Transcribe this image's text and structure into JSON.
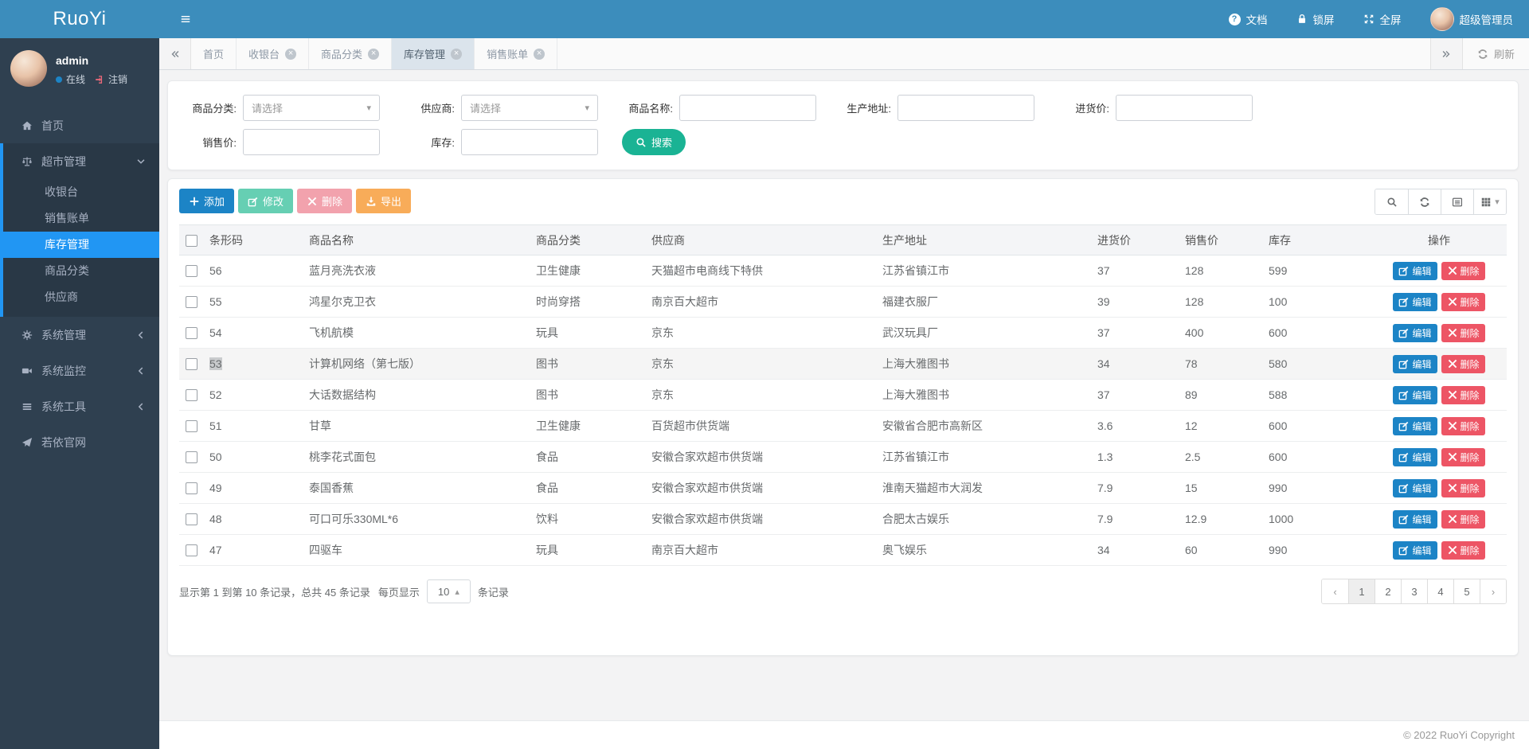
{
  "colors": {
    "navbar": "#3c8dbc",
    "sidebar": "#2f4050",
    "active_menu": "#2196f3",
    "primary": "#1c84c6",
    "success": "#1ab394",
    "danger": "#ed5565",
    "warning": "#f8ac59"
  },
  "navbar": {
    "logo": "RuoYi",
    "doc": "文档",
    "lock": "锁屏",
    "fullscreen": "全屏",
    "user": "超级管理员"
  },
  "sidebar": {
    "username": "admin",
    "status": "在线",
    "logout": "注销",
    "menu": [
      {
        "label": "首页",
        "icon": "home-icon",
        "type": "item"
      },
      {
        "label": "超市管理",
        "icon": "scale-icon",
        "type": "group",
        "expanded": true,
        "children": [
          {
            "label": "收银台"
          },
          {
            "label": "销售账单"
          },
          {
            "label": "库存管理",
            "active": true
          },
          {
            "label": "商品分类"
          },
          {
            "label": "供应商"
          }
        ]
      },
      {
        "label": "系统管理",
        "icon": "gear-icon",
        "type": "collapsed"
      },
      {
        "label": "系统监控",
        "icon": "camera-icon",
        "type": "collapsed"
      },
      {
        "label": "系统工具",
        "icon": "bars-icon",
        "type": "collapsed"
      },
      {
        "label": "若依官网",
        "icon": "plane-icon",
        "type": "item"
      }
    ]
  },
  "tabbar": {
    "tabs": [
      {
        "label": "首页",
        "closable": false,
        "active": false
      },
      {
        "label": "收银台",
        "closable": true,
        "active": false
      },
      {
        "label": "商品分类",
        "closable": true,
        "active": false
      },
      {
        "label": "库存管理",
        "closable": true,
        "active": true
      },
      {
        "label": "销售账单",
        "closable": true,
        "active": false
      }
    ],
    "refresh": "刷新"
  },
  "search": {
    "row1": [
      {
        "label": "商品分类:",
        "type": "select",
        "placeholder": "请选择"
      },
      {
        "label": "供应商:",
        "type": "select",
        "placeholder": "请选择"
      },
      {
        "label": "商品名称:",
        "type": "input",
        "value": ""
      },
      {
        "label": "生产地址:",
        "type": "input",
        "value": ""
      },
      {
        "label": "进货价:",
        "type": "input",
        "value": ""
      }
    ],
    "row2": [
      {
        "label": "销售价:",
        "type": "input",
        "value": ""
      },
      {
        "label": "库存:",
        "type": "input",
        "value": ""
      }
    ],
    "search_button": "搜索"
  },
  "toolbar": {
    "add": "添加",
    "modify": "修改",
    "remove": "删除",
    "export": "导出"
  },
  "table": {
    "columns": [
      "条形码",
      "商品名称",
      "商品分类",
      "供应商",
      "生产地址",
      "进货价",
      "销售价",
      "库存",
      "操作"
    ],
    "edit_label": "编辑",
    "delete_label": "删除",
    "rows": [
      {
        "barcode": "56",
        "name": "蓝月亮洗衣液",
        "category": "卫生健康",
        "supplier": "天猫超市电商线下特供",
        "address": "江苏省镇江市",
        "purchase_price": "37",
        "sale_price": "128",
        "stock": "599"
      },
      {
        "barcode": "55",
        "name": "鸿星尔克卫衣",
        "category": "时尚穿搭",
        "supplier": "南京百大超市",
        "address": "福建衣服厂",
        "purchase_price": "39",
        "sale_price": "128",
        "stock": "100"
      },
      {
        "barcode": "54",
        "name": "飞机航模",
        "category": "玩具",
        "supplier": "京东",
        "address": "武汉玩具厂",
        "purchase_price": "37",
        "sale_price": "400",
        "stock": "600"
      },
      {
        "barcode": "53",
        "name": "计算机网络（第七版）",
        "category": "图书",
        "supplier": "京东",
        "address": "上海大雅图书",
        "purchase_price": "34",
        "sale_price": "78",
        "stock": "580",
        "highlighted": true,
        "selected": true
      },
      {
        "barcode": "52",
        "name": "大话数据结构",
        "category": "图书",
        "supplier": "京东",
        "address": "上海大雅图书",
        "purchase_price": "37",
        "sale_price": "89",
        "stock": "588"
      },
      {
        "barcode": "51",
        "name": "甘草",
        "category": "卫生健康",
        "supplier": "百货超市供货端",
        "address": "安徽省合肥市高新区",
        "purchase_price": "3.6",
        "sale_price": "12",
        "stock": "600"
      },
      {
        "barcode": "50",
        "name": "桃李花式面包",
        "category": "食品",
        "supplier": "安徽合家欢超市供货端",
        "address": "江苏省镇江市",
        "purchase_price": "1.3",
        "sale_price": "2.5",
        "stock": "600"
      },
      {
        "barcode": "49",
        "name": "泰国香蕉",
        "category": "食品",
        "supplier": "安徽合家欢超市供货端",
        "address": "淮南天猫超市大润发",
        "purchase_price": "7.9",
        "sale_price": "15",
        "stock": "990"
      },
      {
        "barcode": "48",
        "name": "可口可乐330ML*6",
        "category": "饮料",
        "supplier": "安徽合家欢超市供货端",
        "address": "合肥太古娱乐",
        "purchase_price": "7.9",
        "sale_price": "12.9",
        "stock": "1000"
      },
      {
        "barcode": "47",
        "name": "四驱车",
        "category": "玩具",
        "supplier": "南京百大超市",
        "address": "奥飞娱乐",
        "purchase_price": "34",
        "sale_price": "60",
        "stock": "990"
      }
    ]
  },
  "pagination": {
    "summary": "显示第 1 到第 10 条记录，总共 45 条记录",
    "page_size_prefix": "每页显示",
    "page_size": "10",
    "page_size_caret": "▴",
    "page_size_suffix": "条记录",
    "prev": "‹",
    "next": "›",
    "pages": [
      "1",
      "2",
      "3",
      "4",
      "5"
    ],
    "active_page": "1"
  },
  "footer": {
    "copyright": "© 2022 RuoYi Copyright"
  }
}
